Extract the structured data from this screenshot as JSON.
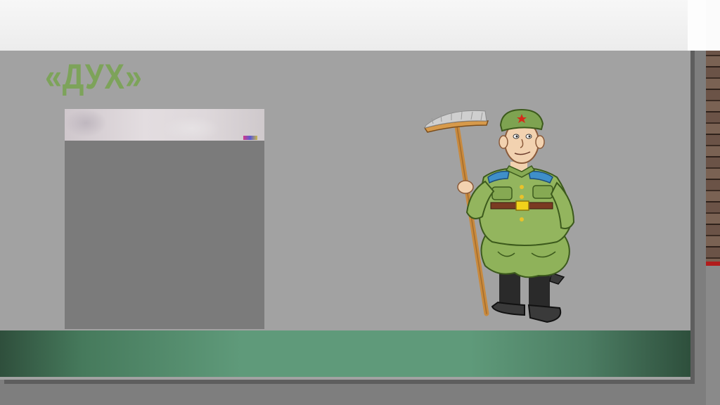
{
  "slide": {
    "title": "«ДУХ»"
  },
  "images": {
    "photo": "photo-placeholder",
    "illustration": "cartoon-soldier-with-broom"
  },
  "colors": {
    "title": "#7da35a",
    "slide_bg": "#a2a2a2",
    "bar_accent": "#5f9a7a"
  }
}
